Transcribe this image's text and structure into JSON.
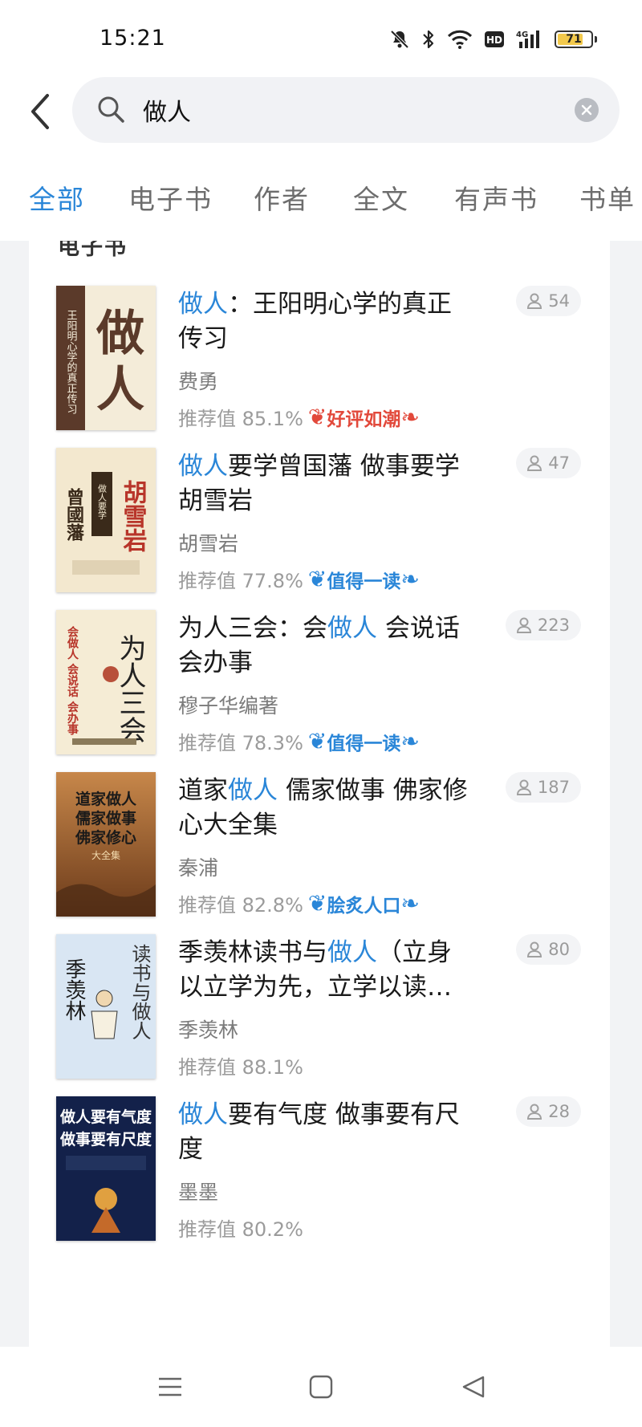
{
  "status_bar": {
    "time": "15:21",
    "battery": "71"
  },
  "search": {
    "query": "做人"
  },
  "tabs": [
    {
      "label": "全部",
      "active": true
    },
    {
      "label": "电子书",
      "active": false
    },
    {
      "label": "作者",
      "active": false
    },
    {
      "label": "全文",
      "active": false
    },
    {
      "label": "有声书",
      "active": false
    },
    {
      "label": "书单",
      "active": false
    }
  ],
  "section_title": "电子书",
  "books": [
    {
      "title_parts": [
        {
          "text": "做人",
          "highlight": true
        },
        {
          "text": "：王阳明心学的真正传习",
          "highlight": false
        }
      ],
      "author": "费勇",
      "recommend": "推荐值 85.1%",
      "badge": {
        "text": "好评如潮",
        "color": "#e2493b"
      },
      "readers": "54",
      "cover": {
        "bg": "#f4ecd9",
        "big_text": "做人",
        "side_text": "王阳明心学的真正传习"
      }
    },
    {
      "title_parts": [
        {
          "text": "做人",
          "highlight": true
        },
        {
          "text": "要学曾国藩 做事要学胡雪岩",
          "highlight": false
        }
      ],
      "author": "胡雪岩",
      "recommend": "推荐值 77.8%",
      "badge": {
        "text": "值得一读",
        "color": "#2a86d8"
      },
      "readers": "47",
      "cover": {
        "bg": "#f3e8cf",
        "big_text": "胡雪岩",
        "side_text": "曾國藩"
      }
    },
    {
      "title_parts": [
        {
          "text": "为人三会：会",
          "highlight": false
        },
        {
          "text": "做人",
          "highlight": true
        },
        {
          "text": " 会说话会办事",
          "highlight": false
        }
      ],
      "author": "穆子华编著",
      "recommend": "推荐值 78.3%",
      "badge": {
        "text": "值得一读",
        "color": "#2a86d8"
      },
      "readers": "223",
      "cover": {
        "bg": "#f5ecd5",
        "big_text": "为人三会",
        "side_text": "会做人 会说话 会办事"
      }
    },
    {
      "title_parts": [
        {
          "text": "道家",
          "highlight": false
        },
        {
          "text": "做人",
          "highlight": true
        },
        {
          "text": " 儒家做事 佛家修心大全集",
          "highlight": false
        }
      ],
      "author": "秦浦",
      "recommend": "推荐值 82.8%",
      "badge": {
        "text": "脍炙人口",
        "color": "#2a86d8"
      },
      "readers": "187",
      "cover": {
        "bg": "#b86a2e",
        "big_text": "道家做人 儒家做事 佛家修心",
        "side_text": "大全集"
      }
    },
    {
      "title_parts": [
        {
          "text": "季羡林读书与",
          "highlight": false
        },
        {
          "text": "做人",
          "highlight": true
        },
        {
          "text": "（立身以立学为先，立学以读…",
          "highlight": false
        }
      ],
      "author": "季羡林",
      "recommend": "推荐值 88.1%",
      "badge": null,
      "readers": "80",
      "cover": {
        "bg": "#d9e6f3",
        "big_text": "读书与做人",
        "side_text": "季羡林"
      }
    },
    {
      "title_parts": [
        {
          "text": "做人",
          "highlight": true
        },
        {
          "text": "要有气度 做事要有尺度",
          "highlight": false
        }
      ],
      "author": "墨墨",
      "recommend": "推荐值 80.2%",
      "badge": null,
      "readers": "28",
      "cover": {
        "bg": "#13214a",
        "big_text": "做人要有气度 做事要有尺度",
        "side_text": ""
      }
    }
  ],
  "nav_bar": {
    "menu": "menu-icon",
    "home": "home-icon",
    "back": "back-icon"
  }
}
